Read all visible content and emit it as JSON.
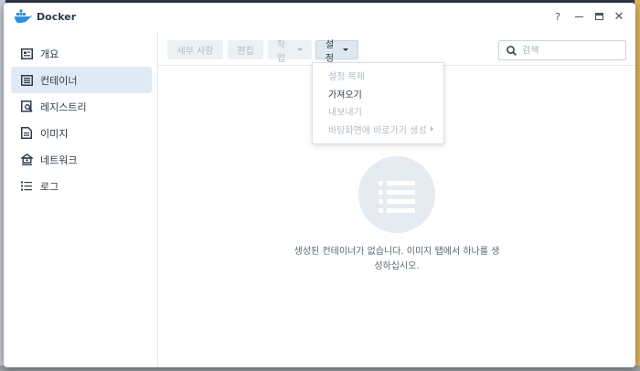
{
  "window": {
    "title": "Docker",
    "help_label": "?"
  },
  "sidebar": {
    "items": [
      {
        "label": "개요",
        "icon": "overview-icon"
      },
      {
        "label": "컨테이너",
        "icon": "container-list-icon",
        "active": true
      },
      {
        "label": "레지스트리",
        "icon": "registry-search-icon"
      },
      {
        "label": "이미지",
        "icon": "image-icon"
      },
      {
        "label": "네트워크",
        "icon": "network-icon"
      },
      {
        "label": "로그",
        "icon": "log-list-icon"
      }
    ]
  },
  "toolbar": {
    "details_label": "세부 사항",
    "edit_label": "편집",
    "action_label": "작업",
    "settings_label": "설정",
    "search_placeholder": "검색",
    "search_value": ""
  },
  "settings_menu": {
    "items": [
      {
        "label": "설정 복제",
        "enabled": false
      },
      {
        "label": "가져오기",
        "enabled": true
      },
      {
        "label": "내보내기",
        "enabled": false
      },
      {
        "label": "바탕화면에 바로가기 생성",
        "enabled": false,
        "submenu": true
      }
    ]
  },
  "empty_state": {
    "line1": "생성된 컨테이너가 없습니다. 이미지 탭에서 하나를 생",
    "line2": "성하십시오."
  },
  "colors": {
    "accent": "#dfeaf5",
    "icon_fg": "#2f3b48",
    "disabled": "#b3bbc4",
    "docker_blue": "#2f8fd8"
  }
}
